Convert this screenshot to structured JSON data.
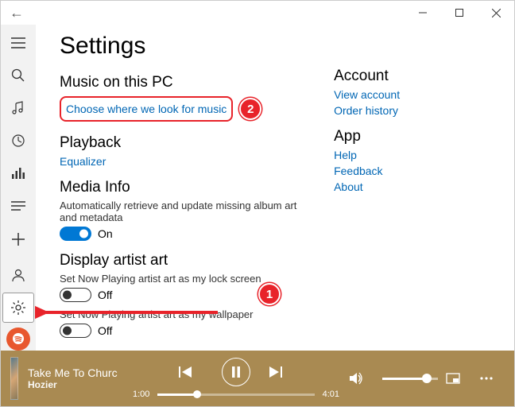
{
  "page_title": "Settings",
  "sections": {
    "music": {
      "heading": "Music on this PC",
      "link": "Choose where we look for music"
    },
    "playback": {
      "heading": "Playback",
      "link": "Equalizer"
    },
    "media": {
      "heading": "Media Info",
      "desc": "Automatically retrieve and update missing album art and metadata",
      "toggle_label": "On"
    },
    "artist": {
      "heading": "Display artist art",
      "lock_desc": "Set Now Playing artist art as my lock screen",
      "lock_label": "Off",
      "wall_desc": "Set Now Playing artist art as my wallpaper",
      "wall_label": "Off"
    }
  },
  "right": {
    "account_heading": "Account",
    "view_account": "View account",
    "order_history": "Order history",
    "app_heading": "App",
    "help": "Help",
    "feedback": "Feedback",
    "about": "About"
  },
  "callouts": {
    "c1": "1",
    "c2": "2"
  },
  "player": {
    "title": "Take Me To Churc",
    "artist": "Hozier",
    "elapsed": "1:00",
    "duration": "4:01"
  }
}
